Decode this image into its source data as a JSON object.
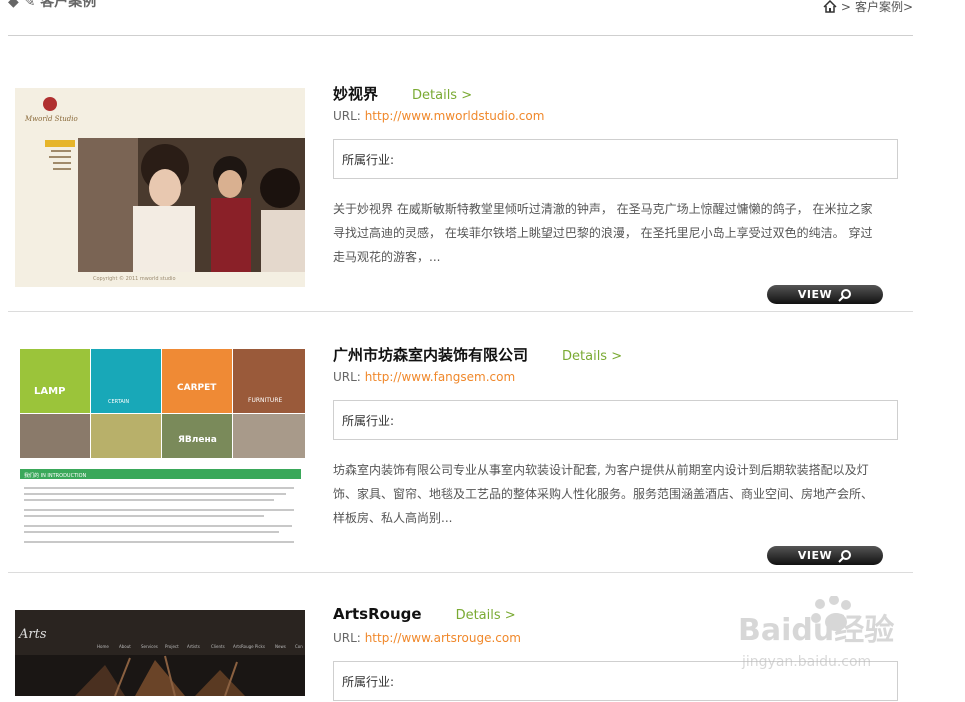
{
  "header": {
    "section_title_cut": "客户案例",
    "breadcrumb_sep": ">",
    "breadcrumb_current": "客户案例>"
  },
  "cases": [
    {
      "title": "妙视界",
      "details": "Details >",
      "url_label": "URL:",
      "url": "http://www.mworldstudio.com",
      "industry_label": "所属行业:",
      "description": "关于妙视界 在威斯敏斯特教堂里倾听过清澈的钟声， 在圣马克广场上惊醒过慵懒的鸽子， 在米拉之家寻找过高迪的灵感， 在埃菲尔铁塔上眺望过巴黎的浪漫， 在圣托里尼小岛上享受过双色的纯洁。 穿过走马观花的游客，...",
      "view_label": "VIEW"
    },
    {
      "title": "广州市坊森室内装饰有限公司",
      "details": "Details >",
      "url_label": "URL:",
      "url": "http://www.fangsem.com",
      "industry_label": "所属行业:",
      "description": "坊森室内装饰有限公司专业从事室内软装设计配套, 为客户提供从前期室内设计到后期软装搭配以及灯饰、家具、窗帘、地毯及工艺品的整体采购人性化服务。服务范围涵盖酒店、商业空间、房地产会所、样板房、私人高尚别...",
      "view_label": "VIEW",
      "thumb_tiles": [
        "LAMP",
        "CERTAIN",
        "CARPET",
        "FURNITURE"
      ],
      "thumb_banner": "我们的 IN INTRODUCTION"
    },
    {
      "title": "ArtsRouge",
      "details": "Details >",
      "url_label": "URL:",
      "url": "http://www.artsrouge.com",
      "industry_label": "所属行业:"
    }
  ],
  "watermark": {
    "brand": "Baidu经验",
    "site": "jingyan.baidu.com"
  },
  "colors": {
    "accent_green": "#7aaa33",
    "link_orange": "#f0882b"
  }
}
